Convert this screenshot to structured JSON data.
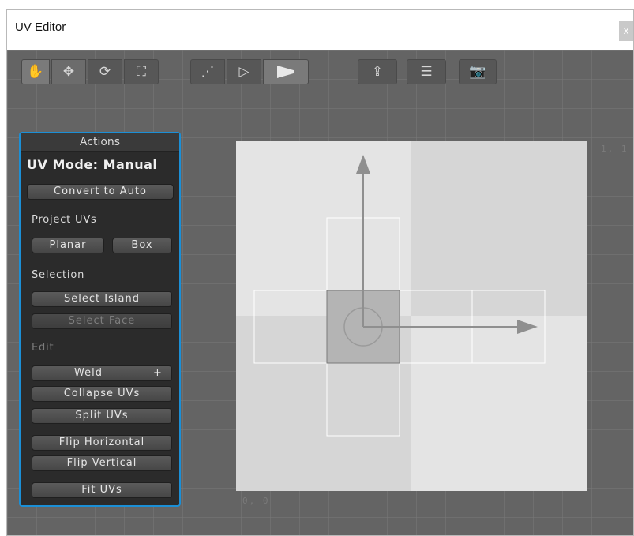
{
  "window": {
    "title": "UV Editor",
    "close_label": "x"
  },
  "toolbar": {
    "groups": [
      {
        "name": "tool-group",
        "buttons": [
          "hand-icon",
          "move-icon",
          "rotate-icon",
          "scale-icon"
        ]
      },
      {
        "name": "select-mode-group",
        "buttons": [
          "vertex-icon",
          "edge-icon",
          "face-icon"
        ]
      },
      {
        "name": "export-group",
        "buttons": [
          "export-icon",
          "settings-icon",
          "camera-icon"
        ]
      }
    ]
  },
  "actions": {
    "header": "Actions",
    "mode": "UV Mode: Manual",
    "convert": "Convert to Auto",
    "project_label": "Project UVs",
    "planar": "Planar",
    "box": "Box",
    "selection_label": "Selection",
    "select_island": "Select Island",
    "select_face": "Select Face",
    "edit_label": "Edit",
    "weld": "Weld",
    "weld_plus": "+",
    "collapse": "Collapse UVs",
    "split": "Split UVs",
    "flip_h": "Flip Horizontal",
    "flip_v": "Flip Vertical",
    "fit": "Fit UVs"
  },
  "canvas": {
    "corner_top_right": "1, 1",
    "corner_bottom_left": "0, 0"
  },
  "colors": {
    "accent": "#1b8fd6",
    "panel_bg": "#2b2b2b",
    "viewport_bg": "#646464"
  }
}
